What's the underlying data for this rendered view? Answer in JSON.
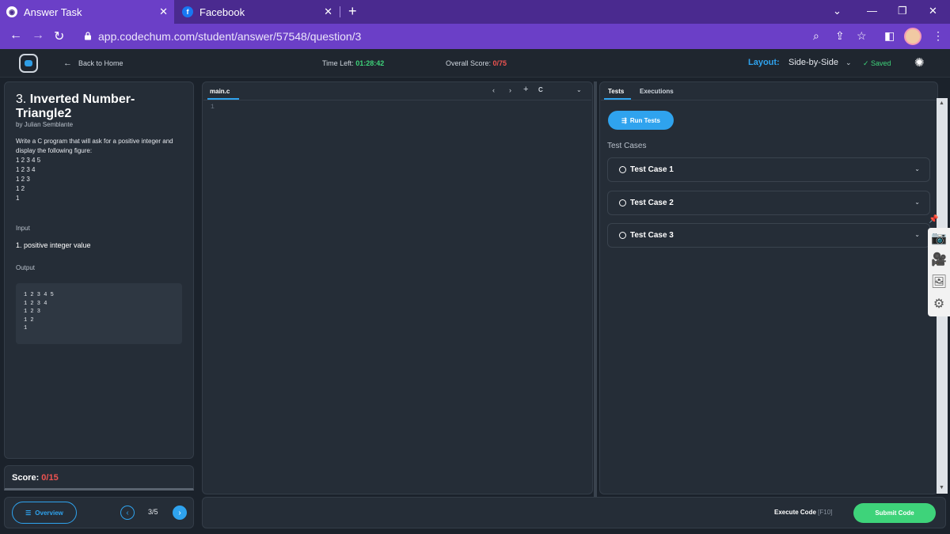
{
  "browser": {
    "tabs": [
      {
        "title": "Answer Task",
        "icon": "codechum-icon",
        "active": true
      },
      {
        "title": "Facebook",
        "icon": "facebook-icon",
        "active": false
      }
    ],
    "url": "app.codechum.com/student/answer/57548/question/3"
  },
  "header": {
    "back_label": "Back to Home",
    "time_label": "Time Left: ",
    "time_value": "01:28:42",
    "score_label": "Overall Score: ",
    "score_value": "0/75",
    "layout_label": "Layout:",
    "layout_value": "Side-by-Side",
    "saved_label": "Saved"
  },
  "problem": {
    "number": "3.",
    "title": "Inverted Number-Triangle2",
    "author": "by Julian Semblante",
    "description": "Write a C program that will ask for a positive integer and display the following figure:",
    "figure": [
      "1 2 3 4 5",
      "1 2 3 4",
      "1 2 3",
      "1 2",
      "1"
    ],
    "input_heading": "Input",
    "input_items": [
      "1. positive integer value"
    ],
    "output_heading": "Output",
    "output_sample": [
      "1 2 3 4 5",
      "1 2 3 4",
      "1 2 3",
      "1 2",
      "1"
    ]
  },
  "score": {
    "label": "Score: ",
    "value": "0/15"
  },
  "nav": {
    "overview_label": "Overview",
    "page": "3/5"
  },
  "editor": {
    "filename": "main.c",
    "language": "C",
    "line_numbers": [
      "1"
    ]
  },
  "tests": {
    "tabs": [
      "Tests",
      "Executions"
    ],
    "run_label": "Run Tests",
    "cases_heading": "Test Cases",
    "cases": [
      "Test Case 1",
      "Test Case 2",
      "Test Case 3"
    ]
  },
  "footer": {
    "execute_label": "Execute Code",
    "execute_shortcut": "[F10]",
    "submit_label": "Submit Code"
  },
  "colors": {
    "accent": "#2fa3ee",
    "success": "#3ed37a",
    "danger": "#ef5350",
    "browser": "#6b3fc7"
  }
}
